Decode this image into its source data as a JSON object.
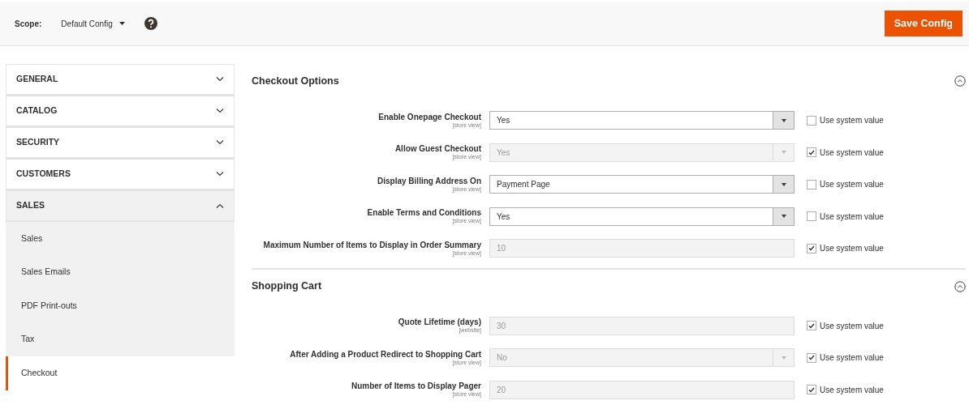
{
  "header": {
    "scope_label": "Scope:",
    "scope_value": "Default Config",
    "save_button": "Save Config"
  },
  "sidebar": {
    "items": [
      {
        "label": "GENERAL",
        "expanded": false
      },
      {
        "label": "CATALOG",
        "expanded": false
      },
      {
        "label": "SECURITY",
        "expanded": false
      },
      {
        "label": "CUSTOMERS",
        "expanded": false
      },
      {
        "label": "SALES",
        "expanded": true,
        "children": [
          {
            "label": "Sales",
            "selected": false
          },
          {
            "label": "Sales Emails",
            "selected": false
          },
          {
            "label": "PDF Print-outs",
            "selected": false
          },
          {
            "label": "Tax",
            "selected": false
          },
          {
            "label": "Checkout",
            "selected": true
          }
        ]
      }
    ]
  },
  "sections": [
    {
      "title": "Checkout Options",
      "expanded": true,
      "fields": [
        {
          "label": "Enable Onepage Checkout",
          "scope": "[store view]",
          "kind": "select",
          "value": "Yes",
          "disabled": false,
          "use_system_label": "Use system value",
          "use_system": false
        },
        {
          "label": "Allow Guest Checkout",
          "scope": "[store view]",
          "kind": "select",
          "value": "Yes",
          "disabled": true,
          "use_system_label": "Use system value",
          "use_system": true
        },
        {
          "label": "Display Billing Address On",
          "scope": "[store view]",
          "kind": "select",
          "value": "Payment Page",
          "disabled": false,
          "use_system_label": "Use system value",
          "use_system": false
        },
        {
          "label": "Enable Terms and Conditions",
          "scope": "[store view]",
          "kind": "select",
          "value": "Yes",
          "disabled": false,
          "use_system_label": "Use system value",
          "use_system": false
        },
        {
          "label": "Maximum Number of Items to Display in Order Summary",
          "scope": "[store view]",
          "kind": "text",
          "value": "10",
          "disabled": true,
          "use_system_label": "Use system value",
          "use_system": true
        }
      ]
    },
    {
      "title": "Shopping Cart",
      "expanded": true,
      "fields": [
        {
          "label": "Quote Lifetime (days)",
          "scope": "[website]",
          "kind": "text",
          "value": "30",
          "disabled": true,
          "use_system_label": "Use system value",
          "use_system": true
        },
        {
          "label": "After Adding a Product Redirect to Shopping Cart",
          "scope": "[store view]",
          "kind": "select",
          "value": "No",
          "disabled": true,
          "use_system_label": "Use system value",
          "use_system": true
        },
        {
          "label": "Number of Items to Display Pager",
          "scope": "[store view]",
          "kind": "text",
          "value": "20",
          "disabled": true,
          "use_system_label": "Use system value",
          "use_system": true
        }
      ]
    }
  ]
}
